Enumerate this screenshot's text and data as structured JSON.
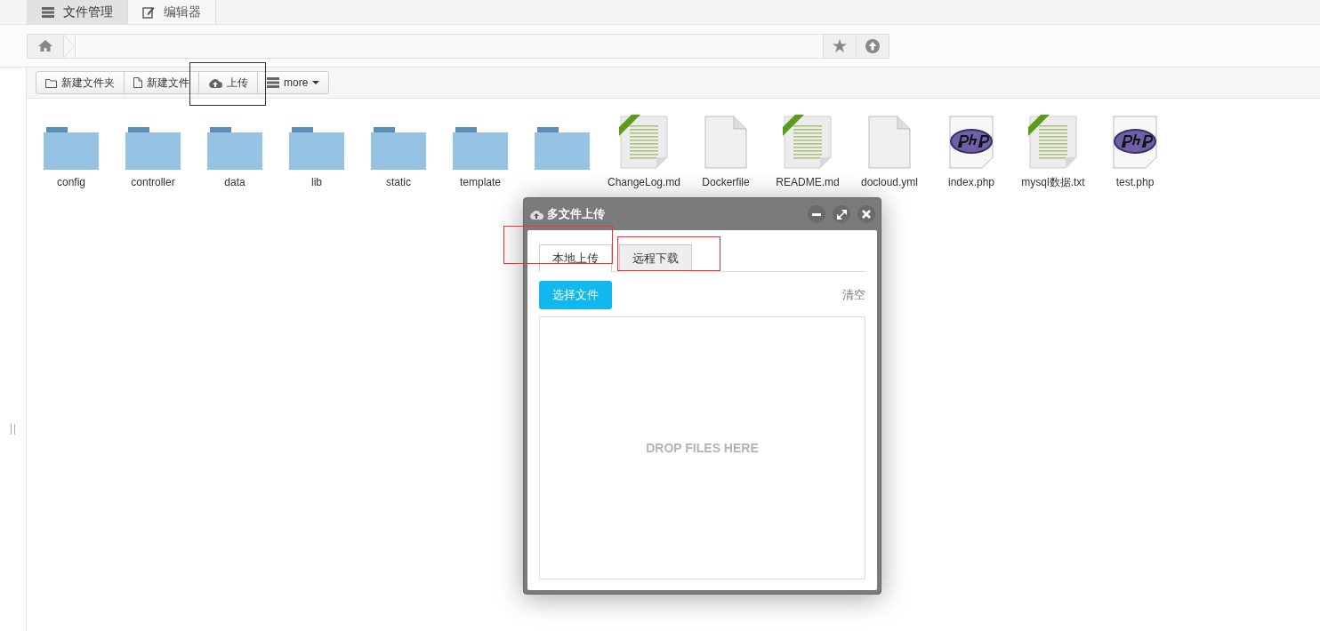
{
  "tabs": [
    {
      "label": "文件管理",
      "selected": true
    },
    {
      "label": "编辑器",
      "selected": false
    }
  ],
  "toolbar": [
    {
      "label": "新建文件夹"
    },
    {
      "label": "新建文件"
    },
    {
      "label": "上传"
    },
    {
      "label": "more"
    }
  ],
  "files": [
    {
      "kind": "folder",
      "name": "config"
    },
    {
      "kind": "folder",
      "name": "controller"
    },
    {
      "kind": "folder",
      "name": "data"
    },
    {
      "kind": "folder",
      "name": "lib"
    },
    {
      "kind": "folder",
      "name": "static"
    },
    {
      "kind": "folder",
      "name": "template"
    },
    {
      "kind": "folder"
    },
    {
      "kind": "text",
      "name": "ChangeLog.md"
    },
    {
      "kind": "blank",
      "name": "Dockerfile"
    },
    {
      "kind": "text",
      "name": "README.md"
    },
    {
      "kind": "blank",
      "name": "docloud.yml"
    },
    {
      "kind": "php",
      "name": "index.php"
    },
    {
      "kind": "text",
      "name": "mysql数据.txt"
    },
    {
      "kind": "php",
      "name": "test.php"
    }
  ],
  "dialog": {
    "title": "多文件上传",
    "tabs": [
      {
        "label": "本地上传",
        "selected": true
      },
      {
        "label": "远程下载",
        "selected": false
      }
    ],
    "choose_button": "选择文件",
    "clear": "清空",
    "drop_hint": "DROP FILES HERE"
  }
}
